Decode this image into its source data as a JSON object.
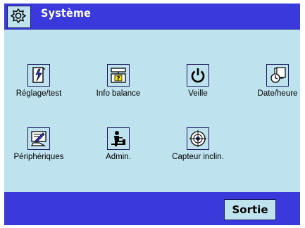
{
  "header": {
    "title": "Système",
    "icon": "gear-icon"
  },
  "tiles": [
    {
      "label": "Réglage/test",
      "icon": "calibration-icon"
    },
    {
      "label": "Info balance",
      "icon": "balance-info-icon"
    },
    {
      "label": "Veille",
      "icon": "power-icon"
    },
    {
      "label": "Date/heure",
      "icon": "clock-icon"
    },
    {
      "label": "Périphériques",
      "icon": "peripherals-icon"
    },
    {
      "label": "Admin.",
      "icon": "admin-icon"
    },
    {
      "label": "Capteur inclin.",
      "icon": "level-sensor-icon"
    }
  ],
  "footer": {
    "exit_label": "Sortie"
  },
  "colors": {
    "bar": "#3939dc",
    "panel": "#bfe3ee",
    "border": "#1a1a60"
  }
}
